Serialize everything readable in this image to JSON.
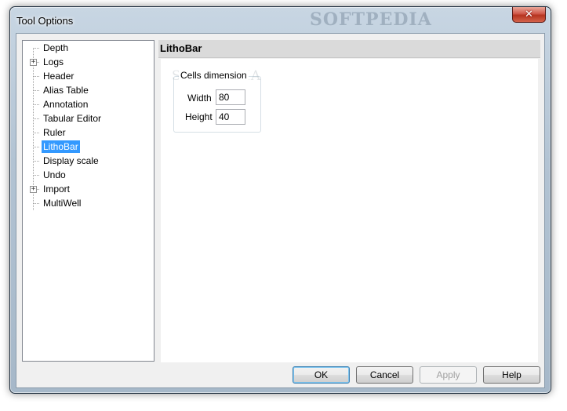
{
  "window": {
    "title": "Tool Options",
    "watermark": "SOFTPEDIA",
    "close_glyph": "✕"
  },
  "tree": {
    "items": [
      {
        "label": "Depth",
        "expandable": false,
        "selected": false
      },
      {
        "label": "Logs",
        "expandable": true,
        "selected": false
      },
      {
        "label": "Header",
        "expandable": false,
        "selected": false
      },
      {
        "label": "Alias Table",
        "expandable": false,
        "selected": false
      },
      {
        "label": "Annotation",
        "expandable": false,
        "selected": false
      },
      {
        "label": "Tabular Editor",
        "expandable": false,
        "selected": false
      },
      {
        "label": "Ruler",
        "expandable": false,
        "selected": false
      },
      {
        "label": "LithoBar",
        "expandable": false,
        "selected": true
      },
      {
        "label": "Display scale",
        "expandable": false,
        "selected": false
      },
      {
        "label": "Undo",
        "expandable": false,
        "selected": false
      },
      {
        "label": "Import",
        "expandable": true,
        "selected": false
      },
      {
        "label": "MultiWell",
        "expandable": false,
        "selected": false
      }
    ],
    "expander_glyph": "+"
  },
  "panel": {
    "title": "LithoBar",
    "group": {
      "title": "Cells dimension",
      "watermark": "SOFTPEDIA",
      "width_label": "Width",
      "width_value": "80",
      "height_label": "Height",
      "height_value": "40"
    }
  },
  "buttons": {
    "ok": "OK",
    "cancel": "Cancel",
    "apply": "Apply",
    "help": "Help"
  },
  "colors": {
    "selection": "#3399ff",
    "close_button": "#c9452f"
  }
}
